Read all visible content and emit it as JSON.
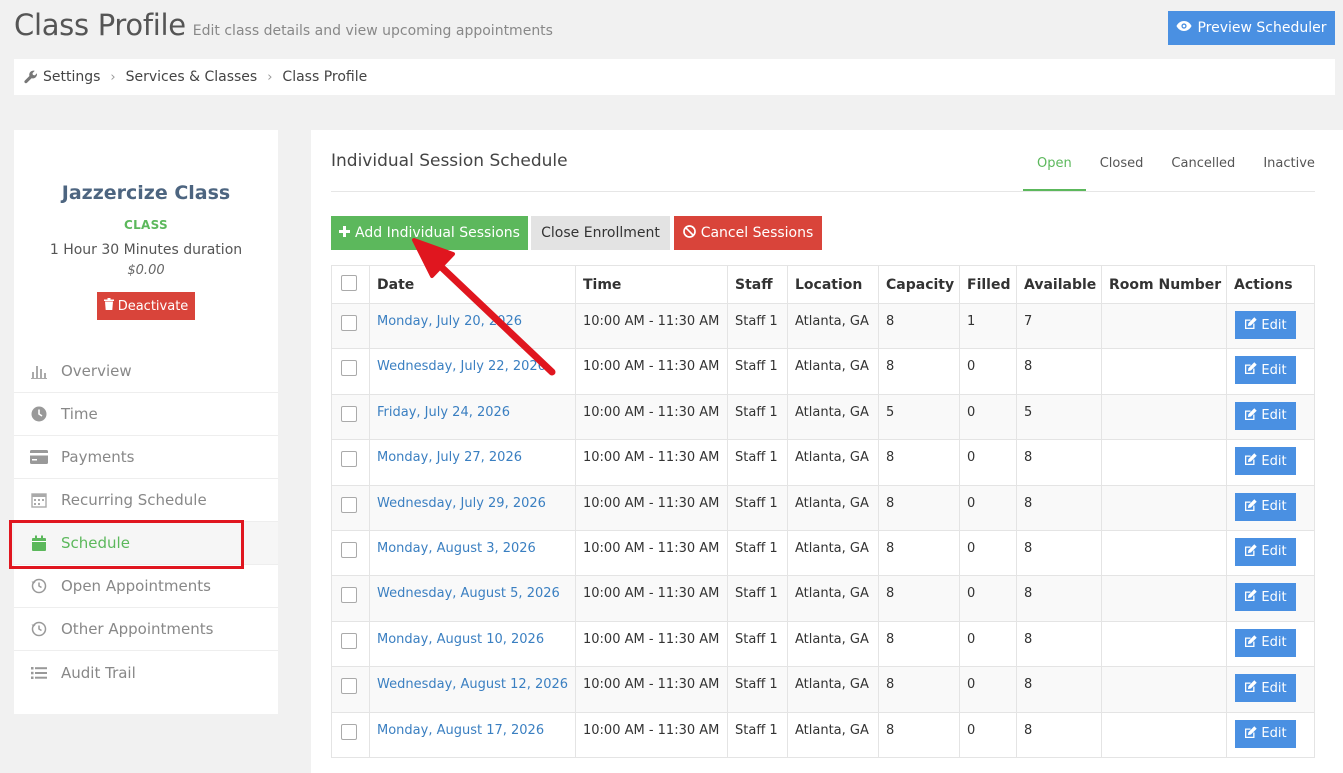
{
  "header": {
    "title": "Class Profile",
    "subtitle": "Edit class details and view upcoming appointments",
    "preview_label": "Preview Scheduler"
  },
  "breadcrumb": [
    "Settings",
    "Services & Classes",
    "Class Profile"
  ],
  "class_info": {
    "name": "Jazzercize Class",
    "type": "CLASS",
    "duration": "1 Hour 30 Minutes duration",
    "price": "$0.00",
    "deactivate_label": "Deactivate"
  },
  "nav": [
    {
      "label": "Overview",
      "icon": "chart-icon"
    },
    {
      "label": "Time",
      "icon": "clock-icon"
    },
    {
      "label": "Payments",
      "icon": "credit-card-icon"
    },
    {
      "label": "Recurring Schedule",
      "icon": "calendar-grid-icon"
    },
    {
      "label": "Schedule",
      "icon": "calendar-icon",
      "active": true
    },
    {
      "label": "Open Appointments",
      "icon": "history-icon"
    },
    {
      "label": "Other Appointments",
      "icon": "history-icon"
    },
    {
      "label": "Audit Trail",
      "icon": "list-icon"
    }
  ],
  "main": {
    "section_title": "Individual Session Schedule",
    "tabs": [
      "Open",
      "Closed",
      "Cancelled",
      "Inactive"
    ],
    "active_tab": "Open",
    "actions": {
      "add_label": "Add Individual Sessions",
      "close_label": "Close Enrollment",
      "cancel_label": "Cancel Sessions"
    },
    "table": {
      "columns": [
        "Date",
        "Time",
        "Staff",
        "Location",
        "Capacity",
        "Filled",
        "Available",
        "Room Number",
        "Actions"
      ],
      "edit_label": "Edit",
      "rows": [
        {
          "date": "Monday, July 20, 2026",
          "time": "10:00 AM - 11:30 AM",
          "staff": "Staff 1",
          "location": "Atlanta, GA",
          "capacity": "8",
          "filled": "1",
          "available": "7",
          "room": ""
        },
        {
          "date": "Wednesday, July 22, 2026",
          "time": "10:00 AM - 11:30 AM",
          "staff": "Staff 1",
          "location": "Atlanta, GA",
          "capacity": "8",
          "filled": "0",
          "available": "8",
          "room": ""
        },
        {
          "date": "Friday, July 24, 2026",
          "time": "10:00 AM - 11:30 AM",
          "staff": "Staff 1",
          "location": "Atlanta, GA",
          "capacity": "5",
          "filled": "0",
          "available": "5",
          "room": ""
        },
        {
          "date": "Monday, July 27, 2026",
          "time": "10:00 AM - 11:30 AM",
          "staff": "Staff 1",
          "location": "Atlanta, GA",
          "capacity": "8",
          "filled": "0",
          "available": "8",
          "room": ""
        },
        {
          "date": "Wednesday, July 29, 2026",
          "time": "10:00 AM - 11:30 AM",
          "staff": "Staff 1",
          "location": "Atlanta, GA",
          "capacity": "8",
          "filled": "0",
          "available": "8",
          "room": ""
        },
        {
          "date": "Monday, August 3, 2026",
          "time": "10:00 AM - 11:30 AM",
          "staff": "Staff 1",
          "location": "Atlanta, GA",
          "capacity": "8",
          "filled": "0",
          "available": "8",
          "room": ""
        },
        {
          "date": "Wednesday, August 5, 2026",
          "time": "10:00 AM - 11:30 AM",
          "staff": "Staff 1",
          "location": "Atlanta, GA",
          "capacity": "8",
          "filled": "0",
          "available": "8",
          "room": ""
        },
        {
          "date": "Monday, August 10, 2026",
          "time": "10:00 AM - 11:30 AM",
          "staff": "Staff 1",
          "location": "Atlanta, GA",
          "capacity": "8",
          "filled": "0",
          "available": "8",
          "room": ""
        },
        {
          "date": "Wednesday, August 12, 2026",
          "time": "10:00 AM - 11:30 AM",
          "staff": "Staff 1",
          "location": "Atlanta, GA",
          "capacity": "8",
          "filled": "0",
          "available": "8",
          "room": ""
        },
        {
          "date": "Monday, August 17, 2026",
          "time": "10:00 AM - 11:30 AM",
          "staff": "Staff 1",
          "location": "Atlanta, GA",
          "capacity": "8",
          "filled": "0",
          "available": "8",
          "room": ""
        }
      ]
    }
  },
  "colors": {
    "accent_blue": "#4a90e2",
    "success_green": "#5cb85c",
    "danger_red": "#d9443a",
    "annotation_red": "#e0161f"
  }
}
